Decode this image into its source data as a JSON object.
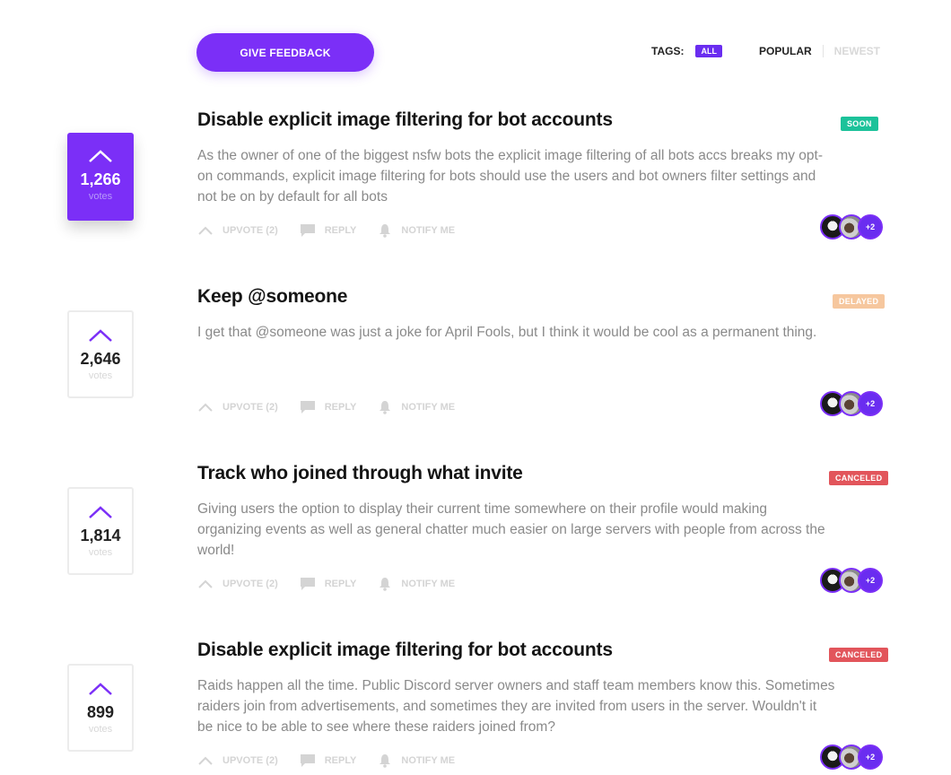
{
  "header": {
    "feedback_label": "GIVE FEEDBACK",
    "tags_label": "TAGS:",
    "tag_all": "ALL",
    "sort_popular": "POPULAR",
    "sort_newest": "NEWEST"
  },
  "colors": {
    "accent": "#7b2ff7",
    "soon": "#1cc29a",
    "delayed": "#f6c79e",
    "canceled": "#e2555b"
  },
  "posts": [
    {
      "votes": "1,266",
      "votes_label": "votes",
      "active": true,
      "title": "Disable explicit image filtering for bot accounts",
      "status": "SOON",
      "body_lines": [
        "As the owner of one of the biggest nsfw bots the explicit image filtering of all bots accs breaks my opt-",
        "on commands, explicit image filtering for bots should use the users and bot owners filter settings and",
        "not be on by default for all bots"
      ],
      "upvote": "UPVOTE (2)",
      "reply": "REPLY",
      "notify": "NOTIFY ME",
      "more_avatars": "+2"
    },
    {
      "votes": "2,646",
      "votes_label": "votes",
      "active": false,
      "title": "Keep @someone",
      "status": "DELAYED",
      "body_lines": [
        "I get that @someone was just a joke for April Fools, but I think it would be cool as a permanent thing."
      ],
      "upvote": "UPVOTE (2)",
      "reply": "REPLY",
      "notify": "NOTIFY ME",
      "more_avatars": "+2"
    },
    {
      "votes": "1,814",
      "votes_label": "votes",
      "active": false,
      "title": "Track who joined through what invite",
      "status": "CANCELED",
      "body_lines": [
        "Giving users the option to display their current time somewhere on their profile would making",
        "organizing events as well as general chatter much easier on large servers with people from across the",
        "world!"
      ],
      "upvote": "UPVOTE (2)",
      "reply": "REPLY",
      "notify": "NOTIFY ME",
      "more_avatars": "+2"
    },
    {
      "votes": "899",
      "votes_label": "votes",
      "active": false,
      "title": "Disable explicit image filtering for bot accounts",
      "status": "CANCELED",
      "body_lines": [
        "Raids happen all the time. Public Discord server owners and staff team members know this. Sometimes",
        "raiders join from advertisements, and sometimes they are invited from users in the server. Wouldn't it",
        "be nice to be able to see where these raiders joined from?"
      ],
      "upvote": "UPVOTE (2)",
      "reply": "REPLY",
      "notify": "NOTIFY ME",
      "more_avatars": "+2"
    }
  ]
}
